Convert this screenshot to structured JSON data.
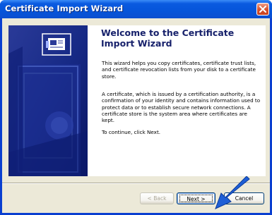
{
  "window": {
    "title": "Certificate Import Wizard"
  },
  "wizard": {
    "heading": "Welcome to the Certificate Import Wizard",
    "paragraph1": "This wizard helps you copy certificates, certificate trust lists, and certificate revocation lists from your disk to a certificate store.",
    "paragraph2": "A certificate, which is issued by a certification authority, is a confirmation of your identity and contains information used to protect data or to establish secure network connections. A certificate store is the system area where certificates are kept.",
    "paragraph3": "To continue, click Next."
  },
  "buttons": {
    "back": "< Back",
    "next": "Next >",
    "cancel": "Cancel"
  },
  "icons": [
    "close-icon",
    "certificate-icon",
    "arrow-pointer-icon"
  ],
  "colors": {
    "titlebar": "#0a5ae0",
    "art_background": "#0d1f73",
    "heading_text": "#17216b",
    "annotation_arrow": "#1f5fd6"
  }
}
